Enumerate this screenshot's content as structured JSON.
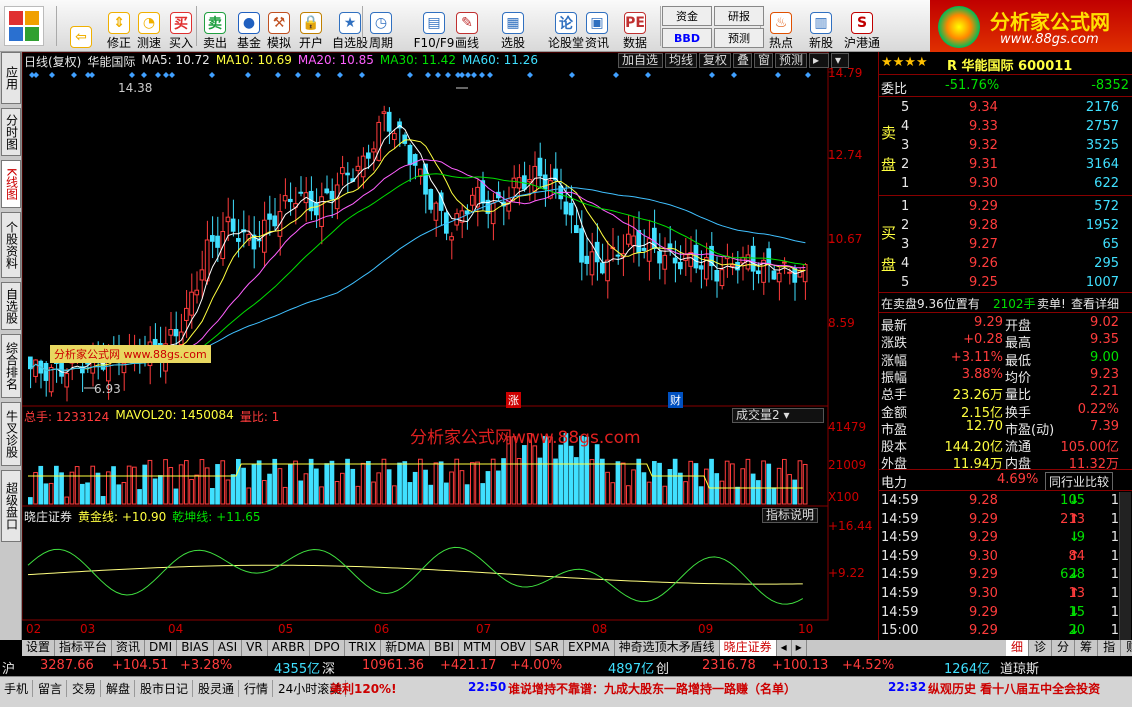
{
  "toolbar": {
    "buttons": [
      {
        "label": "",
        "icon": "back-arrow-icon"
      },
      {
        "label": "修正",
        "icon": "up-down-arrow-icon"
      },
      {
        "label": "测速",
        "icon": "speed-icon"
      },
      {
        "label": "买入",
        "icon": "buy-icon",
        "glyph": "买"
      },
      {
        "label": "卖出",
        "icon": "sell-icon",
        "glyph": "卖"
      },
      {
        "label": "基金",
        "icon": "fund-icon"
      },
      {
        "label": "模拟",
        "icon": "hammer-icon"
      },
      {
        "label": "开户",
        "icon": "lock-icon"
      },
      {
        "label": "自选股",
        "icon": "star-list-icon"
      },
      {
        "label": "周期",
        "icon": "clock-icon"
      },
      {
        "label": "F10/F9",
        "icon": "document-icon"
      },
      {
        "label": "画线",
        "icon": "pencil-icon"
      },
      {
        "label": "选股",
        "icon": "screen-icon"
      },
      {
        "label": "论股堂",
        "icon": "discuss-icon",
        "glyph": "论"
      },
      {
        "label": "资讯",
        "icon": "news-icon"
      },
      {
        "label": "数据",
        "icon": "pe-icon",
        "glyph": "PE"
      },
      {
        "label": "热点",
        "icon": "hot-icon"
      },
      {
        "label": "新股",
        "icon": "ipo-icon"
      },
      {
        "label": "沪港通",
        "icon": "sse-hk-icon"
      }
    ],
    "small": {
      "zijin": "资金",
      "bbd": "BBD",
      "yanbao": "研报",
      "yuce": "预测"
    }
  },
  "brand": {
    "title": "分析家公式网",
    "url": "www.88gs.com"
  },
  "left_tabs": [
    "应用",
    "分时图",
    "K线图",
    "个股资料",
    "自选股",
    "综合排名",
    "牛叉诊股",
    "超级盘口"
  ],
  "chart_header": {
    "main": "日线(复权)",
    "stock": "华能国际",
    "ma5": "MA5: 10.72",
    "ma10": "MA10: 10.69",
    "ma20": "MA20: 10.85",
    "ma30": "MA30: 11.42",
    "ma60": "MA60: 11.26",
    "buttons": [
      "加自选",
      "均线",
      "复权",
      "叠",
      "窗",
      "预测"
    ],
    "high_mark": "14.38",
    "low_mark": "6.93",
    "zhang": "涨",
    "cai": "财",
    "watermark": "分析家公式网 www.88gs.com"
  },
  "price_axis": [
    "14.79",
    "12.74",
    "10.67",
    "8.59"
  ],
  "volume": {
    "label_total": "总手: 1233124",
    "label_mavol": "MAVOL20: 1450084",
    "label_ratio": "量比: 1",
    "selector": "成交量2",
    "axis": [
      "41479",
      "21009",
      "X100"
    ]
  },
  "indicator": {
    "name": "晓庄证券",
    "gold": "黄金线: +10.90",
    "qian": "乾坤线: +11.65",
    "explain": "指标说明",
    "axis": [
      "+16.44",
      "+9.22"
    ]
  },
  "time_axis": [
    "02",
    "03",
    "04",
    "05",
    "06",
    "07",
    "08",
    "09",
    "10"
  ],
  "watermark_main": "分析家公式网www.88gs.com",
  "chart_data": {
    "type": "candlestick",
    "title": "华能国际 日线(复权)",
    "x": [
      "02",
      "03",
      "04",
      "05",
      "06",
      "07",
      "08",
      "09",
      "10"
    ],
    "ylim": [
      6.5,
      14.79
    ],
    "high": 14.38,
    "low": 6.93,
    "close_path": [
      7.1,
      7.0,
      7.2,
      7.3,
      7.4,
      7.5,
      7.6,
      8.4,
      10.2,
      10.8,
      10.3,
      11.0,
      11.6,
      11.2,
      12.0,
      12.3,
      13.6,
      12.8,
      11.5,
      10.6,
      11.6,
      11.2,
      11.9,
      12.1,
      11.6,
      9.9,
      9.8,
      10.4,
      10.2,
      9.9,
      9.9,
      9.6,
      9.9,
      9.7,
      9.6,
      9.55
    ],
    "volume_ylim": [
      0,
      41479
    ],
    "indicator_ylim": [
      4,
      16.44
    ]
  },
  "quote": {
    "stars": "★★★★",
    "title": "R 华能国际 600011",
    "weibi_label": "委比",
    "weibi": "-51.76%",
    "weicha": "-8352",
    "sell_label": [
      "卖",
      "盘"
    ],
    "buy_label": [
      "买",
      "盘"
    ],
    "sells": [
      {
        "n": "5",
        "p": "9.34",
        "v": "2176"
      },
      {
        "n": "4",
        "p": "9.33",
        "v": "2757"
      },
      {
        "n": "3",
        "p": "9.32",
        "v": "3525"
      },
      {
        "n": "2",
        "p": "9.31",
        "v": "3164"
      },
      {
        "n": "1",
        "p": "9.30",
        "v": "622"
      }
    ],
    "buys": [
      {
        "n": "1",
        "p": "9.29",
        "v": "572"
      },
      {
        "n": "2",
        "p": "9.28",
        "v": "1952"
      },
      {
        "n": "3",
        "p": "9.27",
        "v": "65"
      },
      {
        "n": "4",
        "p": "9.26",
        "v": "295"
      },
      {
        "n": "5",
        "p": "9.25",
        "v": "1007"
      }
    ],
    "notice": "在卖盘9.36位置有",
    "notice_vol": "2102手",
    "notice_tail": "卖单!",
    "notice_link": "查看详细",
    "stats": [
      {
        "l1": "最新",
        "v1": "9.29",
        "l2": "开盘",
        "v2": "9.02"
      },
      {
        "l1": "涨跌",
        "v1": "+0.28",
        "l2": "最高",
        "v2": "9.35"
      },
      {
        "l1": "涨幅",
        "v1": "+3.11%",
        "l2": "最低",
        "v2": "9.00"
      },
      {
        "l1": "振幅",
        "v1": "3.88%",
        "l2": "均价",
        "v2": "9.23"
      },
      {
        "l1": "总手",
        "v1": "23.26万",
        "l2": "量比",
        "v2": "2.21"
      },
      {
        "l1": "金额",
        "v1": "2.15亿",
        "l2": "换手",
        "v2": "0.22%"
      },
      {
        "l1": "市盈",
        "v1": "12.70",
        "l2": "市盈(动)",
        "v2": "7.39"
      },
      {
        "l1": "股本",
        "v1": "144.20亿",
        "l2": "流通",
        "v2": "105.00亿"
      },
      {
        "l1": "外盘",
        "v1": "11.94万",
        "l2": "内盘",
        "v2": "11.32万"
      }
    ],
    "industry": "电力",
    "industry_pct": "4.69%",
    "industry_btn": "同行业比较",
    "ticks": [
      {
        "t": "14:59",
        "p": "9.28",
        "v": "105",
        "d": "down",
        "n": "1"
      },
      {
        "t": "14:59",
        "p": "9.29",
        "v": "213",
        "d": "up",
        "n": "1"
      },
      {
        "t": "14:59",
        "p": "9.29",
        "v": "9",
        "d": "down",
        "n": "1"
      },
      {
        "t": "14:59",
        "p": "9.30",
        "v": "84",
        "d": "up",
        "n": "1"
      },
      {
        "t": "14:59",
        "p": "9.29",
        "v": "628",
        "d": "down",
        "n": "1"
      },
      {
        "t": "14:59",
        "p": "9.30",
        "v": "13",
        "d": "up",
        "n": "1"
      },
      {
        "t": "14:59",
        "p": "9.29",
        "v": "15",
        "d": "down",
        "n": "1"
      },
      {
        "t": "15:00",
        "p": "9.29",
        "v": "20",
        "d": "down",
        "n": "1"
      }
    ],
    "tabs": [
      "细",
      "诊",
      "分",
      "筹",
      "指",
      "财"
    ]
  },
  "bottom_tabs": [
    "设置",
    "指标平台",
    "资讯",
    "DMI",
    "BIAS",
    "ASI",
    "VR",
    "ARBR",
    "DPO",
    "TRIX",
    "新DMA",
    "BBI",
    "MTM",
    "OBV",
    "SAR",
    "EXPMA",
    "神奇选顶木矛盾线",
    "晓庄证券"
  ],
  "ticker": {
    "sh_label": "沪",
    "sh": "3287.66",
    "sh_chg": "+104.51",
    "sh_pct": "+3.28%",
    "sh_amt": "4355亿",
    "sz_label": "深",
    "sz": "10961.36",
    "sz_chg": "+421.17",
    "sz_pct": "+4.00%",
    "sz_amt": "4897亿",
    "cy_label": "创",
    "cy": "2316.78",
    "cy_chg": "+100.13",
    "cy_pct": "+4.52%",
    "cy_amt": "1264亿",
    "dj_label": "道琼斯"
  },
  "status": {
    "items": [
      "手机",
      "留言",
      "交易",
      "解盘",
      "股市日记",
      "股灵通",
      "行情",
      "24小时滚动"
    ],
    "promo": "美利120%!",
    "news1_time": "22:50",
    "news1": "谁说增持不靠谱：九成大股东一路增持一路赚（名单）",
    "news2_time": "22:32",
    "news2": "纵观历史 看十八届五中全会投资"
  }
}
